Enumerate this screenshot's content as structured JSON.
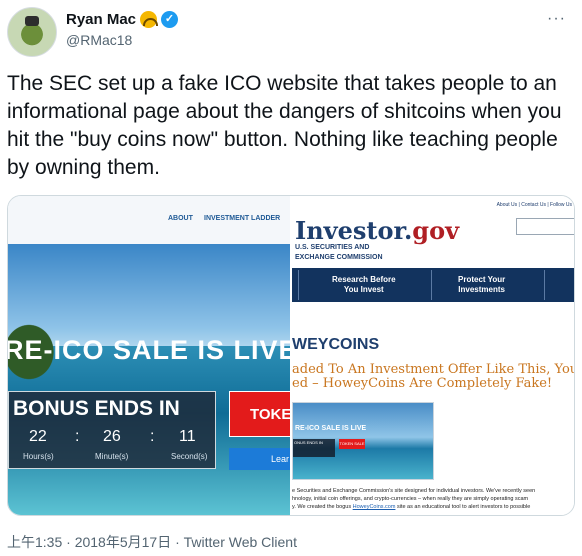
{
  "author": {
    "name": "Ryan Mac",
    "handle": "@RMac18",
    "emoji_icon": "headphones-face-icon",
    "verified_icon": "verified-badge-icon"
  },
  "tweet": {
    "text": "The SEC set up a fake ICO website that takes people to an informational page about the dangers of shitcoins when you hit the \"buy coins now\" button. Nothing like teaching people by owning them."
  },
  "left_screenshot": {
    "nav": [
      "ABOUT",
      "INVESTMENT LADDER"
    ],
    "sale_title": "RE-ICO SALE IS LIVE",
    "bonus": "BONUS ENDS IN",
    "countdown": [
      {
        "value": "22",
        "label": "Hours(s)"
      },
      {
        "value": "26",
        "label": "Minute(s)"
      },
      {
        "value": "11",
        "label": "Second(s)"
      }
    ],
    "token_button": "TOKE",
    "learn_button": "Lear"
  },
  "right_screenshot": {
    "top_links": "About Us  |  Contact Us  |  Follow Us",
    "logo_main": "Investor.",
    "logo_suffix": "gov",
    "agency_line1": "U.S. SECURITIES AND",
    "agency_line2": "EXCHANGE COMMISSION",
    "nav_items": [
      {
        "line1": "Research Before",
        "line2": "You Invest"
      },
      {
        "line1": "Protect Your",
        "line2": "Investments"
      }
    ],
    "howey": "WEYCOINS",
    "headline_line1": "aded To An Investment Offer Like This, You C",
    "headline_line2": "ed – HoweyCoins Are Completely Fake!",
    "thumb_title": "RE-ICO SALE IS LIVE",
    "thumb_bonus": "ONUS ENDS IN",
    "thumb_token": "TOKEN SALE",
    "paragraph_line1": "e Securities and Exchange Commission's site designed for individual investors. We've recently seen",
    "paragraph_line2": "hnology, initial coin offerings, and crypto-currencies – when really they are simply operating scam",
    "paragraph_line3_a": "y. We created the bogus ",
    "paragraph_link": "HoweyCoins.com",
    "paragraph_line3_b": " site as an educational tool to alert investors to possible"
  },
  "meta": {
    "timestamp": "上午1:35 · 2018年5月17日 · Twitter Web Client"
  }
}
